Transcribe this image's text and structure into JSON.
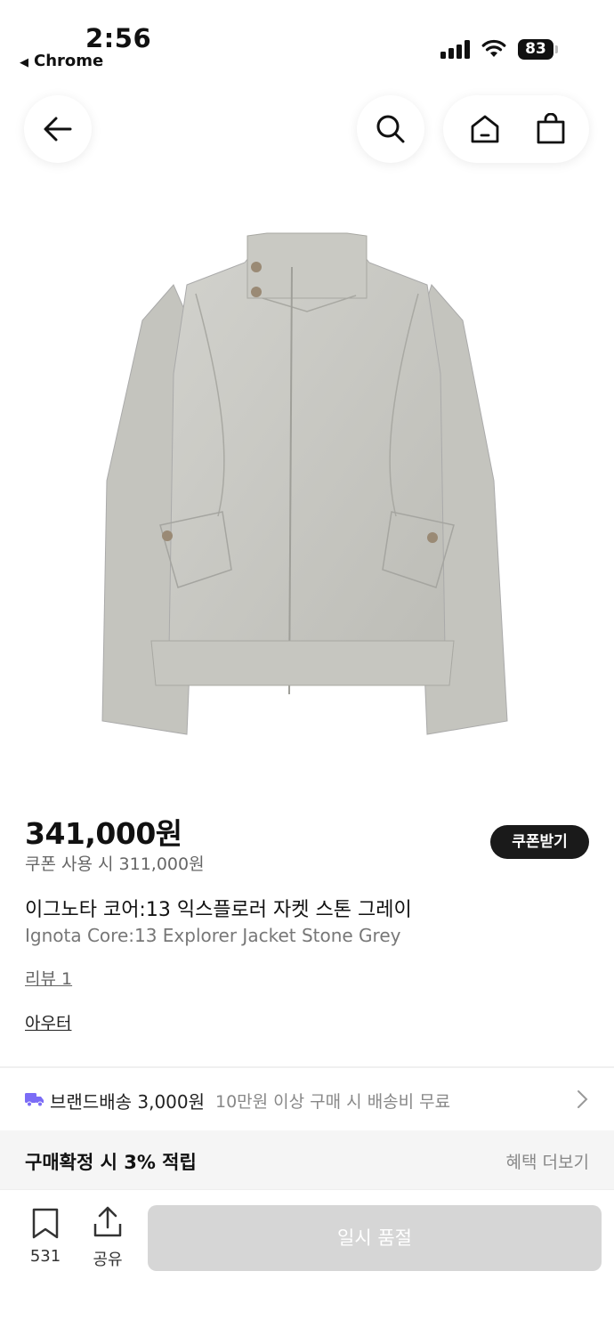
{
  "status": {
    "time": "2:56",
    "back_app": "Chrome",
    "battery": "83"
  },
  "nav": {
    "back_icon": "arrow-left-icon",
    "search_icon": "search-icon",
    "home_icon": "home-icon",
    "bag_icon": "shopping-bag-icon"
  },
  "product": {
    "image_subject": "jacket",
    "price": "341,000원",
    "coupon_price": "쿠폰 사용 시 311,000원",
    "coupon_button": "쿠폰받기",
    "name_ko": "이그노타 코어:13 익스플로러 자켓 스톤 그레이",
    "name_en": "Ignota Core:13 Explorer Jacket Stone Grey",
    "review_link": "리뷰 1",
    "category_link": "아우터"
  },
  "shipping": {
    "label": "브랜드배송 3,000원",
    "note": "10만원 이상 구매 시 배송비 무료",
    "icon": "truck-icon"
  },
  "benefit": {
    "title": "구매확정 시 3% 적립",
    "link": "혜택 더보기"
  },
  "bottom": {
    "bookmark_count": "531",
    "share_label": "공유",
    "soldout_label": "일시 품절"
  },
  "colors": {
    "accent_truck": "#7b6cf6",
    "soldout_bg": "#d6d6d6",
    "dark": "#1a1a1a"
  }
}
